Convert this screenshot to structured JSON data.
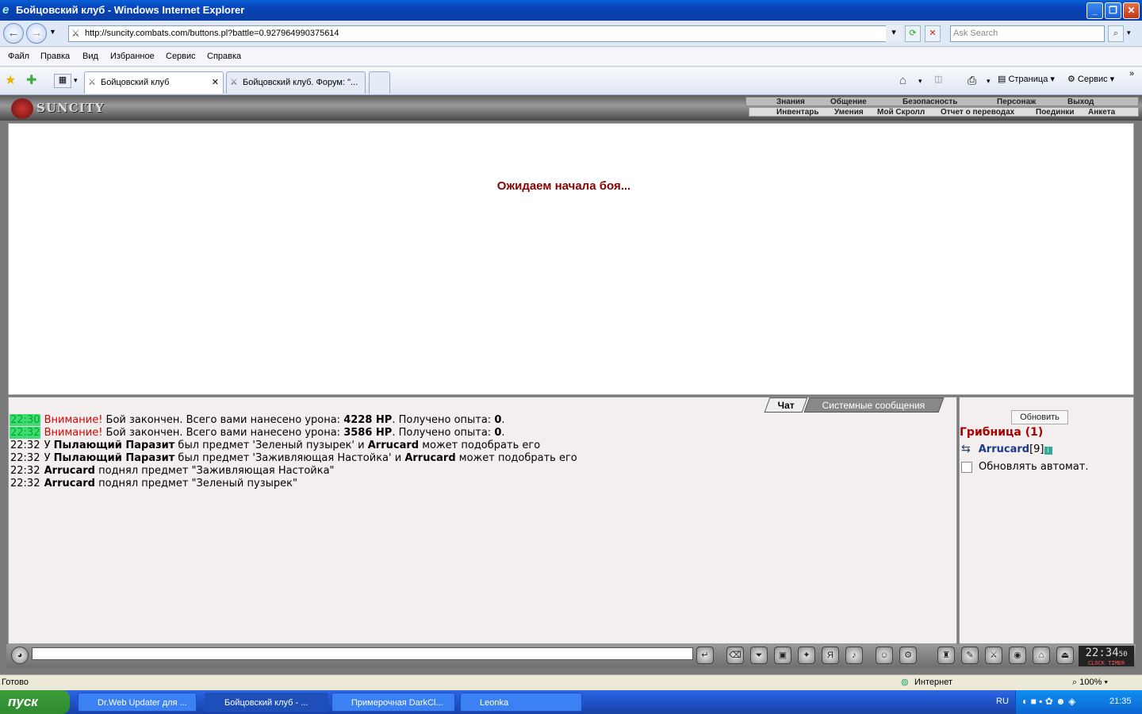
{
  "window": {
    "title": "Бойцовский клуб - Windows Internet Explorer"
  },
  "address": {
    "url": "http://suncity.combats.com/buttons.pl?battle=0.927964990375614",
    "search_placeholder": "Ask Search"
  },
  "menu": {
    "items": [
      "Файл",
      "Правка",
      "Вид",
      "Избранное",
      "Сервис",
      "Справка"
    ]
  },
  "tabs": [
    {
      "label": "Бойцовский клуб"
    },
    {
      "label": "Бойцовский клуб. Форум: \"..."
    }
  ],
  "toolbar": {
    "page_label": "Страница",
    "tools_label": "Сервис"
  },
  "game": {
    "logo": "SUNCITY",
    "menu_main": [
      "Знания",
      "Общение",
      "Безопасность",
      "Персонаж",
      "Выход"
    ],
    "menu_sub": [
      "Инвентарь",
      "Умения",
      "Мой Скролл",
      "Отчет о переводах",
      "Поединки",
      "Анкета"
    ],
    "waiting_text": "Ожидаем начала боя...",
    "chat_tabs": [
      "Чат",
      "Системные сообщения"
    ],
    "messages": [
      {
        "time": "22:30",
        "parts": [
          {
            "t": "Внимание! ",
            "s": "warn"
          },
          {
            "t": "Бой закончен. Всего вами нанесено урона: "
          },
          {
            "t": "4228 HP",
            "s": "b"
          },
          {
            "t": ". Получено опыта: "
          },
          {
            "t": "0",
            "s": "b"
          },
          {
            "t": "."
          }
        ],
        "highlight": true
      },
      {
        "time": "22:32",
        "parts": [
          {
            "t": "Внимание! ",
            "s": "warn"
          },
          {
            "t": "Бой закончен. Всего вами нанесено урона: "
          },
          {
            "t": "3586 HP",
            "s": "b"
          },
          {
            "t": ". Получено опыта: "
          },
          {
            "t": "0",
            "s": "b"
          },
          {
            "t": "."
          }
        ],
        "highlight": true
      },
      {
        "time": "22:32",
        "parts": [
          {
            "t": "У "
          },
          {
            "t": "Пылающий Паразит",
            "s": "b"
          },
          {
            "t": " был предмет 'Зеленый пузырек' и "
          },
          {
            "t": "Arrucard",
            "s": "b"
          },
          {
            "t": " может подобрать его"
          }
        ],
        "highlight": false
      },
      {
        "time": "22:32",
        "parts": [
          {
            "t": "У "
          },
          {
            "t": "Пылающий Паразит",
            "s": "b"
          },
          {
            "t": " был предмет 'Заживляющая Настойка' и "
          },
          {
            "t": "Arrucard",
            "s": "b"
          },
          {
            "t": " может подобрать его"
          }
        ],
        "highlight": false
      },
      {
        "time": "22:32",
        "parts": [
          {
            "t": "Arrucard",
            "s": "b"
          },
          {
            "t": " поднял предмет \"Заживляющая Настойка\""
          }
        ],
        "highlight": false
      },
      {
        "time": "22:32",
        "parts": [
          {
            "t": "Arrucard",
            "s": "b"
          },
          {
            "t": " поднял предмет \"Зеленый пузырек\""
          }
        ],
        "highlight": false
      }
    ],
    "side": {
      "refresh_label": "Обновить",
      "room": "Грибница (1)",
      "user_nick": "Arrucard",
      "user_level": "[9]",
      "auto_refresh_label": "Обновлять автомат."
    },
    "clock": {
      "time": "22:34",
      "seconds": "50",
      "label": "CLOCK TIMER"
    }
  },
  "status": {
    "left": "Готово",
    "zone": "Интернет",
    "zoom": "100%"
  },
  "taskbar": {
    "start": "пуск",
    "tasks": [
      "Dr.Web Updater для ...",
      "Бойцовский клуб - ...",
      "Примерочная DarkCl...",
      "Leonka"
    ],
    "lang": "RU",
    "time": "21:35"
  },
  "colors": {
    "accent": "#8b0000",
    "chat_bg": "#f3efef",
    "highlight_time": "#3fdb74"
  }
}
